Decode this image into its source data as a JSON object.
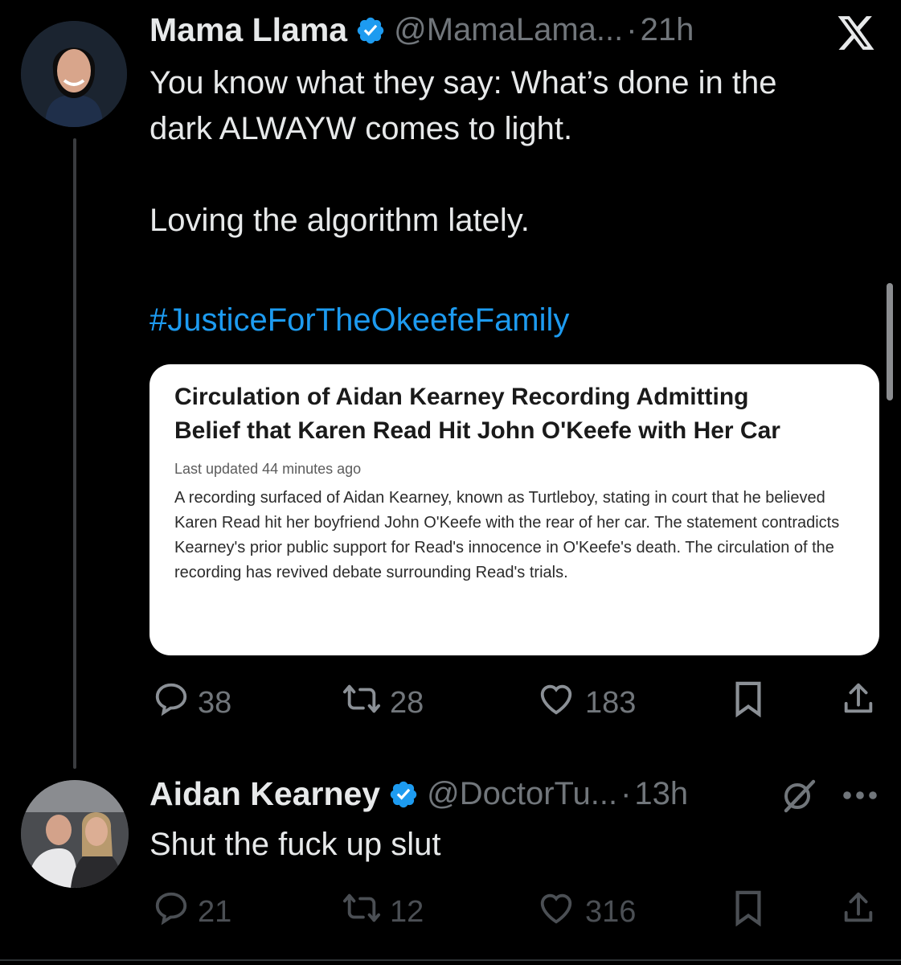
{
  "tweet1": {
    "name": "Mama Llama",
    "handle": "@MamaLama...",
    "dot": "·",
    "time": "21h",
    "text": "You know what they say: What’s done in the\ndark ALWAYW comes to light.\n\nLoving the algorithm lately.",
    "hashtag": "#JusticeForTheOkeefeFamily",
    "card": {
      "title": "Circulation of Aidan Kearney Recording Admitting Belief that Karen Read Hit John O'Keefe with Her Car",
      "updated": "Last updated 44 minutes ago",
      "body": "A recording surfaced of Aidan Kearney, known as Turtleboy, stating in court that he believed Karen Read hit her boyfriend John O'Keefe with the rear of her car. The statement contradicts Kearney's prior public support for Read's innocence in O'Keefe's death. The circulation of the recording has revived debate surrounding Read's trials."
    },
    "replies": "38",
    "reposts": "28",
    "likes": "183"
  },
  "tweet2": {
    "name": "Aidan Kearney",
    "handle": "@DoctorTu...",
    "dot": "·",
    "time": "13h",
    "text": "Shut the fuck up slut",
    "replies": "21",
    "reposts": "12",
    "likes": "316"
  },
  "colors": {
    "background": "#000000",
    "text": "#e7e9ea",
    "muted": "#71767b",
    "link": "#1d9bf0",
    "verified": "#1d9bf0"
  },
  "icons": [
    "verified-badge-icon",
    "x-logo-icon",
    "grok-icon",
    "more-icon",
    "reply-icon",
    "repost-icon",
    "like-icon",
    "bookmark-icon",
    "share-icon"
  ]
}
